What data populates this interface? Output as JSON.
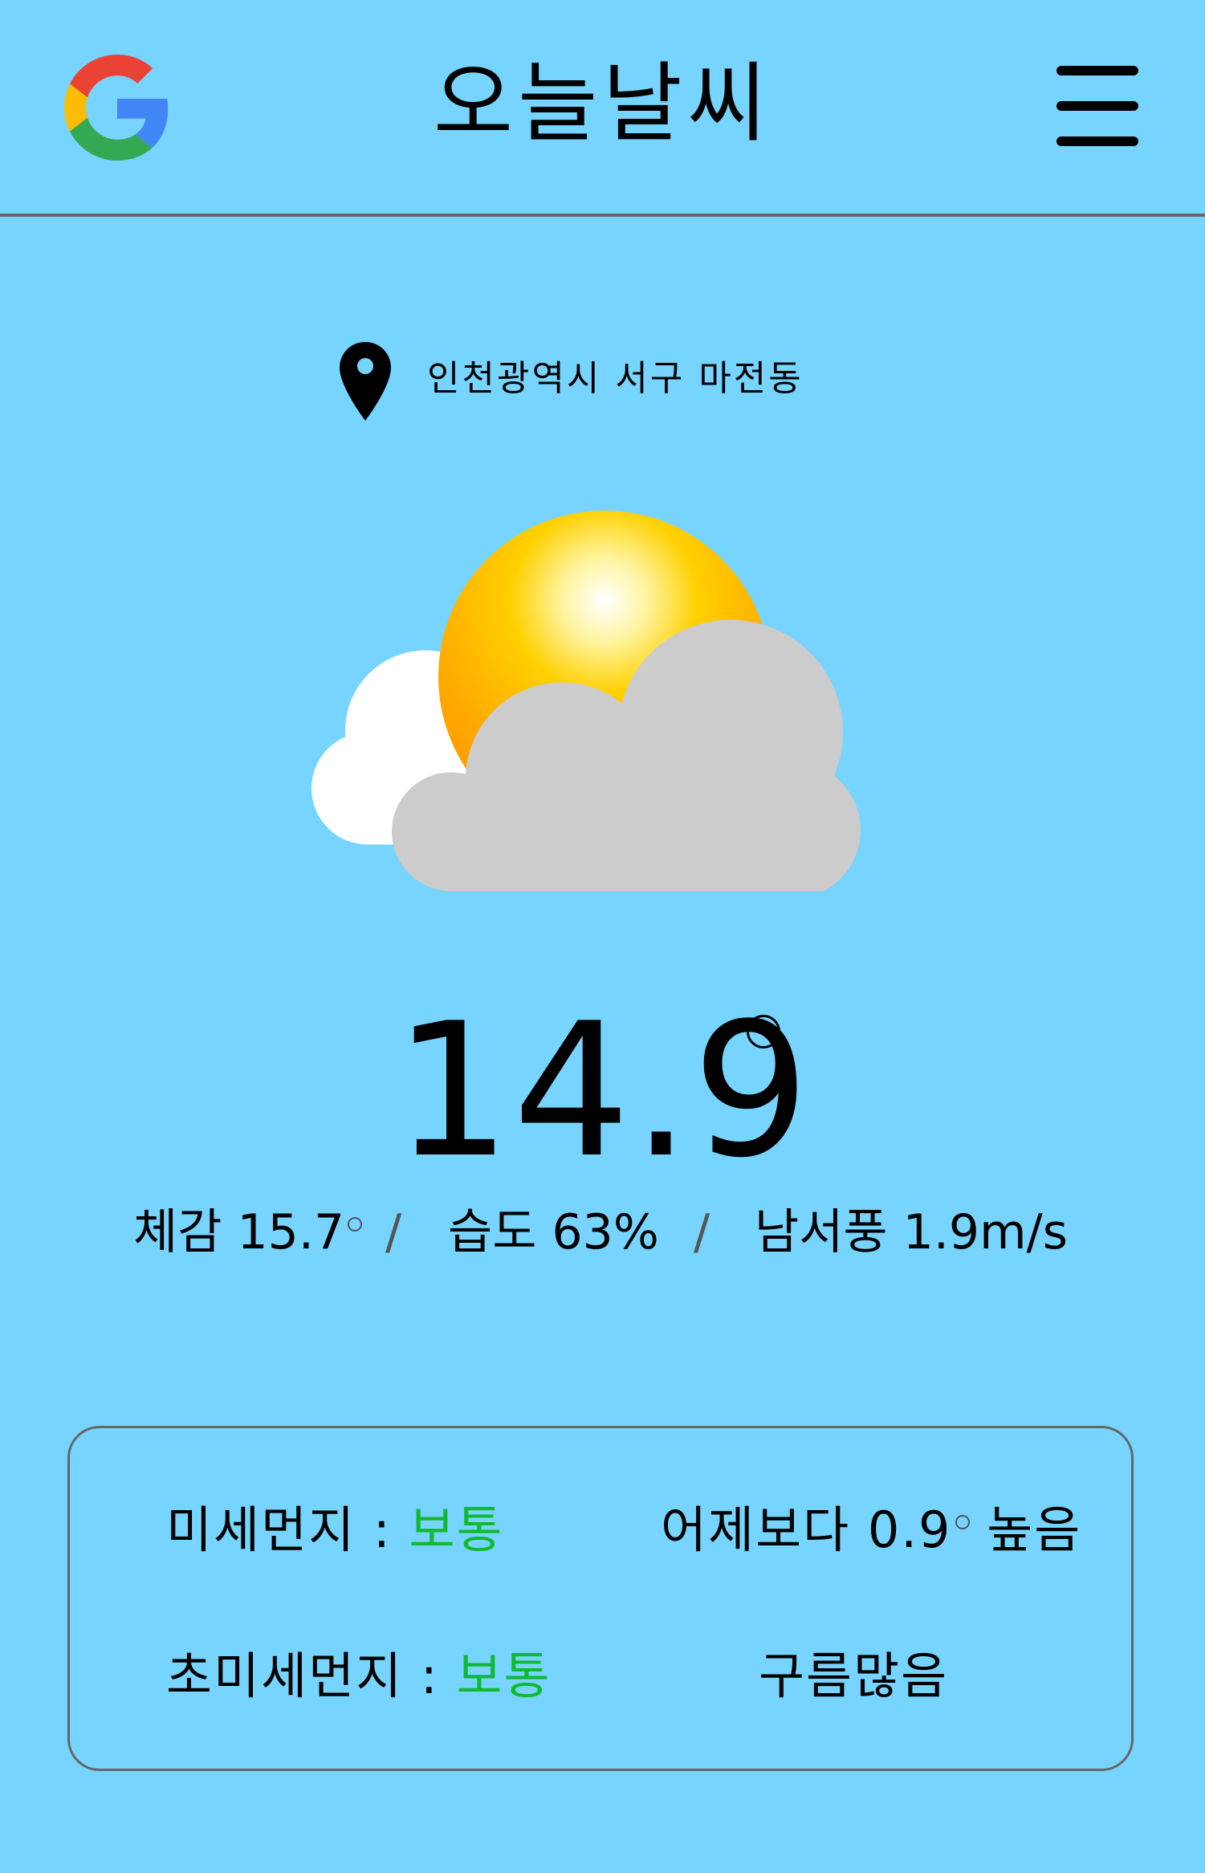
{
  "header": {
    "logo_icon": "google-g-icon",
    "title": "오늘날씨",
    "menu_icon": "hamburger-menu-icon"
  },
  "location": {
    "icon": "map-pin-icon",
    "text": "인천광역시 서구 마전동"
  },
  "weather": {
    "icon": "sun-behind-clouds-icon",
    "temperature": "14.9",
    "feels_like_label": "체감",
    "feels_like": "15.7",
    "humidity_label": "습도",
    "humidity": "63%",
    "wind_direction": "남서풍",
    "wind_speed": "1.9m/s",
    "separator": "/"
  },
  "panel": {
    "fine_dust_label": "미세먼지 :",
    "fine_dust_value": "보통",
    "ultrafine_dust_label": "초미세먼지 :",
    "ultrafine_dust_value": "보통",
    "compare_prefix": "어제보다",
    "compare_value": "0.9",
    "compare_suffix": "높음",
    "sky_condition": "구름많음"
  },
  "colors": {
    "background": "#76d4fe",
    "good_status": "#11b931",
    "divider": "#666666"
  }
}
